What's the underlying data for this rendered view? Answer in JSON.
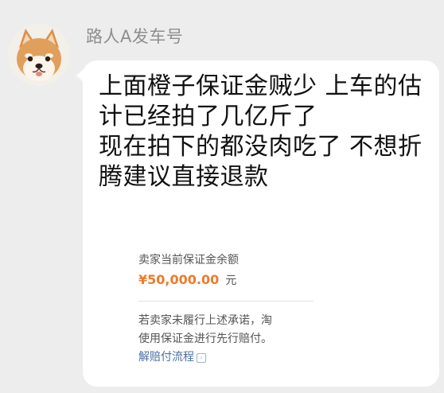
{
  "chat": {
    "sender_name": "路人A发车号",
    "avatar_icon": "shiba-dog-avatar-icon",
    "message_lines": [
      "上面橙子保证金贼少 上车的估",
      "计已经拍了几亿斤了",
      "现在拍下的都没肉吃了 不想折",
      "腾建议直接退款"
    ]
  },
  "card": {
    "deposit_label": "卖家当前保证金余额",
    "amount": "¥50,000.00",
    "unit": "元",
    "note_line1": "若卖家未履行上述承诺，淘",
    "note_line2": "使用保证金进行先行赔付。",
    "link_label": "解赔付流程",
    "link_icon": "chevron-right-icon",
    "amount_color": "#ee7b2c",
    "link_color": "#4a6fa5"
  }
}
